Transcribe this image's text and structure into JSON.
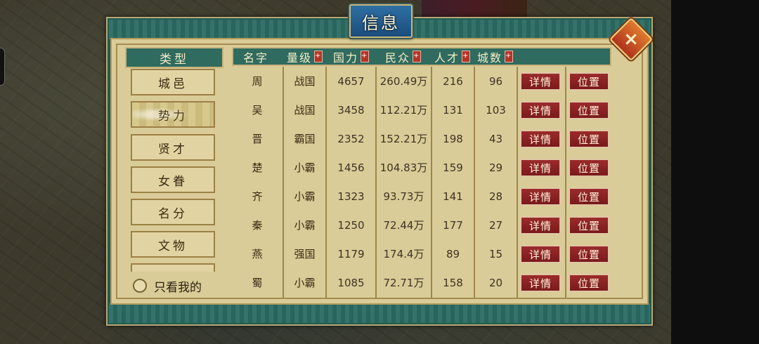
{
  "dialog": {
    "title": "信息"
  },
  "close_button": {
    "icon": "close-icon",
    "glyph": "×"
  },
  "categories": {
    "header": "类型",
    "items": [
      {
        "label": "城邑"
      },
      {
        "label": "势力"
      },
      {
        "label": "贤才"
      },
      {
        "label": "女眷"
      },
      {
        "label": "名分"
      },
      {
        "label": "文物"
      },
      {
        "label": ""
      }
    ],
    "active_index": 1,
    "only_mine_label": "只看我的"
  },
  "table": {
    "headers": {
      "name": "名字",
      "rank": "量级",
      "power": "国力",
      "population": "民众",
      "talent": "人才",
      "cities": "城数"
    },
    "sort_mark": "+",
    "rows": [
      {
        "name": "周",
        "rank": "战国",
        "power": "4657",
        "population": "260.49万",
        "talent": "216",
        "cities": "96",
        "detail": "详情",
        "position": "位置"
      },
      {
        "name": "吴",
        "rank": "战国",
        "power": "3458",
        "population": "112.21万",
        "talent": "131",
        "cities": "103",
        "detail": "详情",
        "position": "位置"
      },
      {
        "name": "晋",
        "rank": "霸国",
        "power": "2352",
        "population": "152.21万",
        "talent": "198",
        "cities": "43",
        "detail": "详情",
        "position": "位置"
      },
      {
        "name": "楚",
        "rank": "小霸",
        "power": "1456",
        "population": "104.83万",
        "talent": "159",
        "cities": "29",
        "detail": "详情",
        "position": "位置"
      },
      {
        "name": "齐",
        "rank": "小霸",
        "power": "1323",
        "population": "93.73万",
        "talent": "141",
        "cities": "28",
        "detail": "详情",
        "position": "位置"
      },
      {
        "name": "秦",
        "rank": "小霸",
        "power": "1250",
        "population": "72.44万",
        "talent": "177",
        "cities": "27",
        "detail": "详情",
        "position": "位置"
      },
      {
        "name": "燕",
        "rank": "强国",
        "power": "1179",
        "population": "174.4万",
        "talent": "89",
        "cities": "15",
        "detail": "详情",
        "position": "位置"
      },
      {
        "name": "蜀",
        "rank": "小霸",
        "power": "1085",
        "population": "72.71万",
        "talent": "158",
        "cities": "20",
        "detail": "详情",
        "position": "位置"
      }
    ]
  },
  "colors": {
    "frame_teal": "#1f5b52",
    "panel_parchment": "#d9cc98",
    "header_teal": "#2f6b5e",
    "button_red": "#8b2426",
    "title_blue": "#1b4d7c"
  }
}
